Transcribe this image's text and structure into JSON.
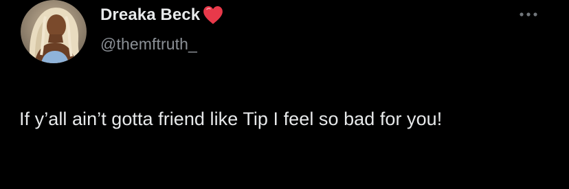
{
  "author": {
    "display_name": "Dreaka Beck",
    "name_emoji": "heart-icon",
    "handle": "@themftruth_",
    "avatar": "profile-photo"
  },
  "tweet": {
    "text": "If y’all ain’t gotta friend like Tip I feel so bad for you!"
  },
  "menu": {
    "icon": "more-icon"
  },
  "colors": {
    "background": "#000000",
    "primary_text": "#e7e9ea",
    "secondary_text": "#8b9096",
    "heart": "#e8394a"
  }
}
